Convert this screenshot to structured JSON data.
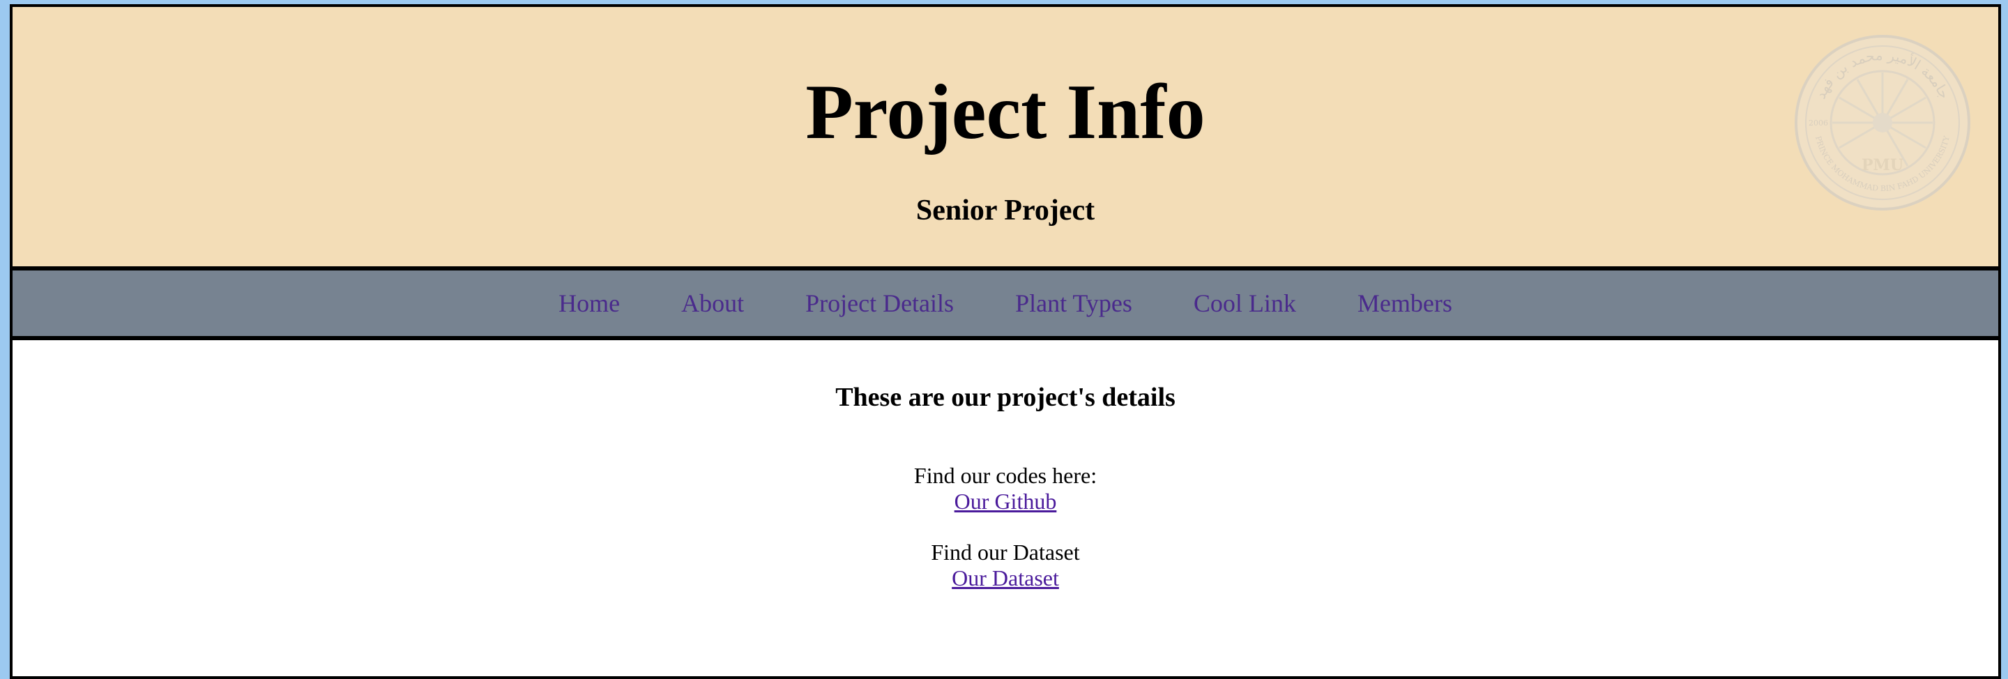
{
  "header": {
    "title": "Project Info",
    "subtitle": "Senior Project",
    "seal": {
      "icon": "university-seal-icon",
      "arc_text_top": "جامعة الأمير محمد بن فهد",
      "arc_text_bottom": "PRINCE MOHAMMAD BIN FAHD UNIVERSITY",
      "year": "2006",
      "monogram": "PMU"
    }
  },
  "nav": {
    "items": [
      {
        "label": "Home"
      },
      {
        "label": "About"
      },
      {
        "label": "Project Details"
      },
      {
        "label": "Plant Types"
      },
      {
        "label": "Cool Link"
      },
      {
        "label": "Members"
      }
    ]
  },
  "main": {
    "heading": "These are our project's details",
    "codes_text": "Find our codes here:",
    "codes_link": "Our Github",
    "dataset_text": "Find our Dataset",
    "dataset_link": "Our Dataset"
  },
  "colors": {
    "page_background": "#9cc9f0",
    "header_background": "#f3ddb7",
    "nav_background": "#778391",
    "nav_link": "#4a2a8c",
    "body_link": "#4a1a9b"
  }
}
